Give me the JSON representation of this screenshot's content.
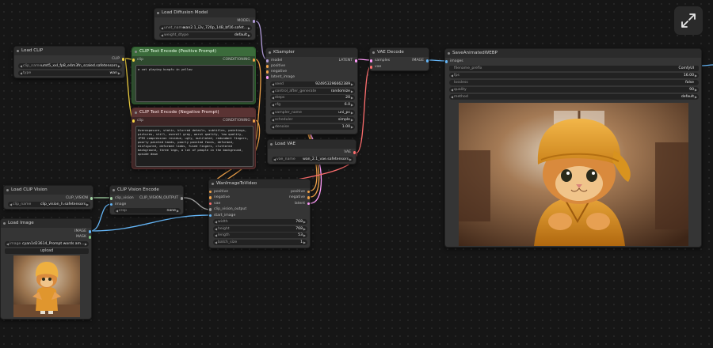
{
  "nodes": {
    "load_diffusion_model": {
      "title": "Load Diffusion Model",
      "out_model": "MODEL",
      "unet_label": "unet_name",
      "unet_value": "wan2.1_i2v_720p_14B_bf16.safet...",
      "weight_label": "weight_dtype",
      "weight_value": "default"
    },
    "load_clip": {
      "title": "Load CLIP",
      "out_clip": "CLIP",
      "clip_name_label": "clip_name",
      "clip_name_value": "umt5_xxl_fp8_e4m3fn_scaled.safetensors",
      "type_label": "type",
      "type_value": "wan"
    },
    "clip_positive": {
      "title": "CLIP Text Encode (Positive Prompt)",
      "in_clip": "clip",
      "out_cond": "CONDITIONING",
      "text": "a cat playing kungfu in yellow"
    },
    "clip_negative": {
      "title": "CLIP Text Encode (Negative Prompt)",
      "in_clip": "clip",
      "out_cond": "CONDITIONING",
      "text": "Overexposure, static, blurred details, subtitles, paintings, pictures, still, overall gray, worst quality, low quality, JPEG compression residue, ugly, mutilated, redundant fingers, poorly painted hands, poorly painted faces, deformed, disfigured, deformed limbs, fused fingers, cluttered background, three legs, a lot of people in the background, upside down"
    },
    "ksampler": {
      "title": "KSampler",
      "in_model": "model",
      "in_positive": "positive",
      "in_negative": "negative",
      "in_latent": "latent_image",
      "out_latent": "LATENT",
      "seed_label": "seed",
      "seed_value": "924953296662389",
      "control_label": "control_after_generate",
      "control_value": "randomize",
      "steps_label": "steps",
      "steps_value": "20",
      "cfg_label": "cfg",
      "cfg_value": "6.0",
      "sampler_label": "sampler_name",
      "sampler_value": "uni_pc",
      "scheduler_label": "scheduler",
      "scheduler_value": "simple",
      "denoise_label": "denoise",
      "denoise_value": "1.00"
    },
    "vae_decode": {
      "title": "VAE Decode",
      "in_samples": "samples",
      "in_vae": "vae",
      "out_image": "IMAGE"
    },
    "load_vae": {
      "title": "Load VAE",
      "out_vae": "VAE",
      "vae_label": "vae_name",
      "vae_value": "wan_2.1_vae.safetensors"
    },
    "save_webp": {
      "title": "SaveAnimatedWEBP",
      "in_images": "images",
      "prefix_label": "filename_prefix",
      "prefix_value": "ComfyUI",
      "fps_label": "fps",
      "fps_value": "16.00",
      "lossless_label": "lossless",
      "lossless_value": "false",
      "quality_label": "quality",
      "quality_value": "90",
      "method_label": "method",
      "method_value": "default"
    },
    "load_clip_vision": {
      "title": "Load CLIP Vision",
      "out": "CLIP_VISION",
      "clip_label": "clip_name",
      "clip_value": "clip_vision_h.safetensors"
    },
    "clip_vision_encode": {
      "title": "CLIP Vision Encode",
      "in_clip_vision": "clip_vision",
      "in_image": "image",
      "out": "CLIP_VISION_OUTPUT",
      "crop_label": "crop",
      "crop_value": "none"
    },
    "wan_i2v": {
      "title": "WanImageToVideo",
      "in_positive": "positive",
      "in_negative": "negative",
      "in_vae": "vae",
      "in_clip_vision_output": "clip_vision_output",
      "in_start_image": "start_image",
      "out_positive": "positive",
      "out_negative": "negative",
      "out_latent": "latent",
      "width_label": "width",
      "width_value": "768",
      "height_label": "height",
      "height_value": "768",
      "length_label": "length",
      "length_value": "53",
      "batch_label": "batch_size",
      "batch_value": "1"
    },
    "load_image": {
      "title": "Load Image",
      "out_image": "IMAGE",
      "out_mask": "MASK",
      "image_label": "image",
      "image_value": "cyan1d23614_Prompt words am...",
      "upload_label": "upload"
    }
  },
  "colors": {
    "model": "#b39ddb",
    "clip": "#f5d442",
    "conditioning": "#f0a24a",
    "latent": "#ff9cf9",
    "vae": "#ff6e6e",
    "image": "#64b5f6",
    "clip_vision": "#a5d6a7",
    "clip_vision_output": "#9e9e9e",
    "mask": "#81c784"
  },
  "icons": {
    "expand": "expand-icon"
  }
}
